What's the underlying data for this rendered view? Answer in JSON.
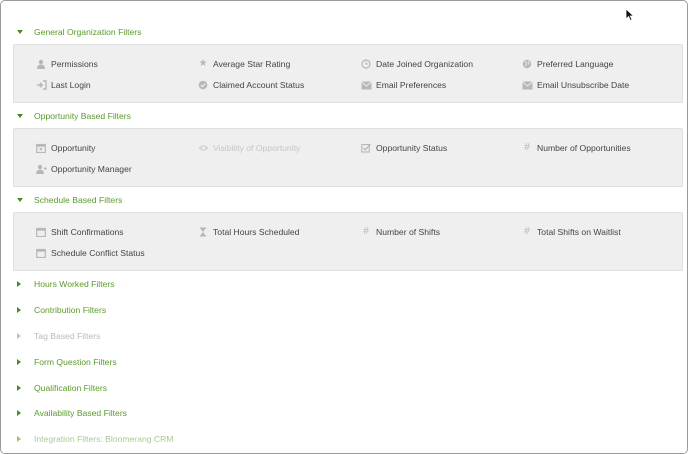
{
  "sections": {
    "general": {
      "label": "General Organization Filters",
      "items": [
        {
          "label": "Permissions",
          "icon": "person-icon"
        },
        {
          "label": "Average Star Rating",
          "icon": "star-icon"
        },
        {
          "label": "Date Joined Organization",
          "icon": "clock-icon"
        },
        {
          "label": "Preferred Language",
          "icon": "globe-icon"
        },
        {
          "label": "Last Login",
          "icon": "sign-in-icon"
        },
        {
          "label": "Claimed Account Status",
          "icon": "check-circle-icon"
        },
        {
          "label": "Email Preferences",
          "icon": "envelope-icon"
        },
        {
          "label": "Email Unsubscribe Date",
          "icon": "envelope-icon"
        }
      ]
    },
    "opportunity": {
      "label": "Opportunity Based Filters",
      "items": [
        {
          "label": "Opportunity",
          "icon": "calendar-icon"
        },
        {
          "label": "Visibility of Opportunity",
          "icon": "eye-icon",
          "disabled": true
        },
        {
          "label": "Opportunity Status",
          "icon": "checkbox-icon"
        },
        {
          "label": "Number of Opportunities",
          "icon": "hashtag-icon"
        },
        {
          "label": "Opportunity Manager",
          "icon": "user-manager-icon"
        }
      ]
    },
    "schedule": {
      "label": "Schedule Based Filters",
      "items": [
        {
          "label": "Shift Confirmations",
          "icon": "calendar-icon"
        },
        {
          "label": "Total Hours Scheduled",
          "icon": "hourglass-icon"
        },
        {
          "label": "Number of Shifts",
          "icon": "hashtag-icon"
        },
        {
          "label": "Total Shifts on Waitlist",
          "icon": "hashtag-icon"
        },
        {
          "label": "Schedule Conflict Status",
          "icon": "calendar-icon"
        }
      ]
    },
    "collapsed": [
      {
        "label": "Hours Worked Filters"
      },
      {
        "label": "Contribution Filters"
      },
      {
        "label": "Tag Based Filters",
        "disabled": true
      },
      {
        "label": "Form Question Filters"
      },
      {
        "label": "Qualification Filters"
      },
      {
        "label": "Availability Based Filters"
      },
      {
        "label": "Integration Filters: Bloomerang CRM"
      }
    ]
  },
  "colors": {
    "accent": "#5a9a2a",
    "panel": "#efefef",
    "icon": "#b7b7b7"
  }
}
